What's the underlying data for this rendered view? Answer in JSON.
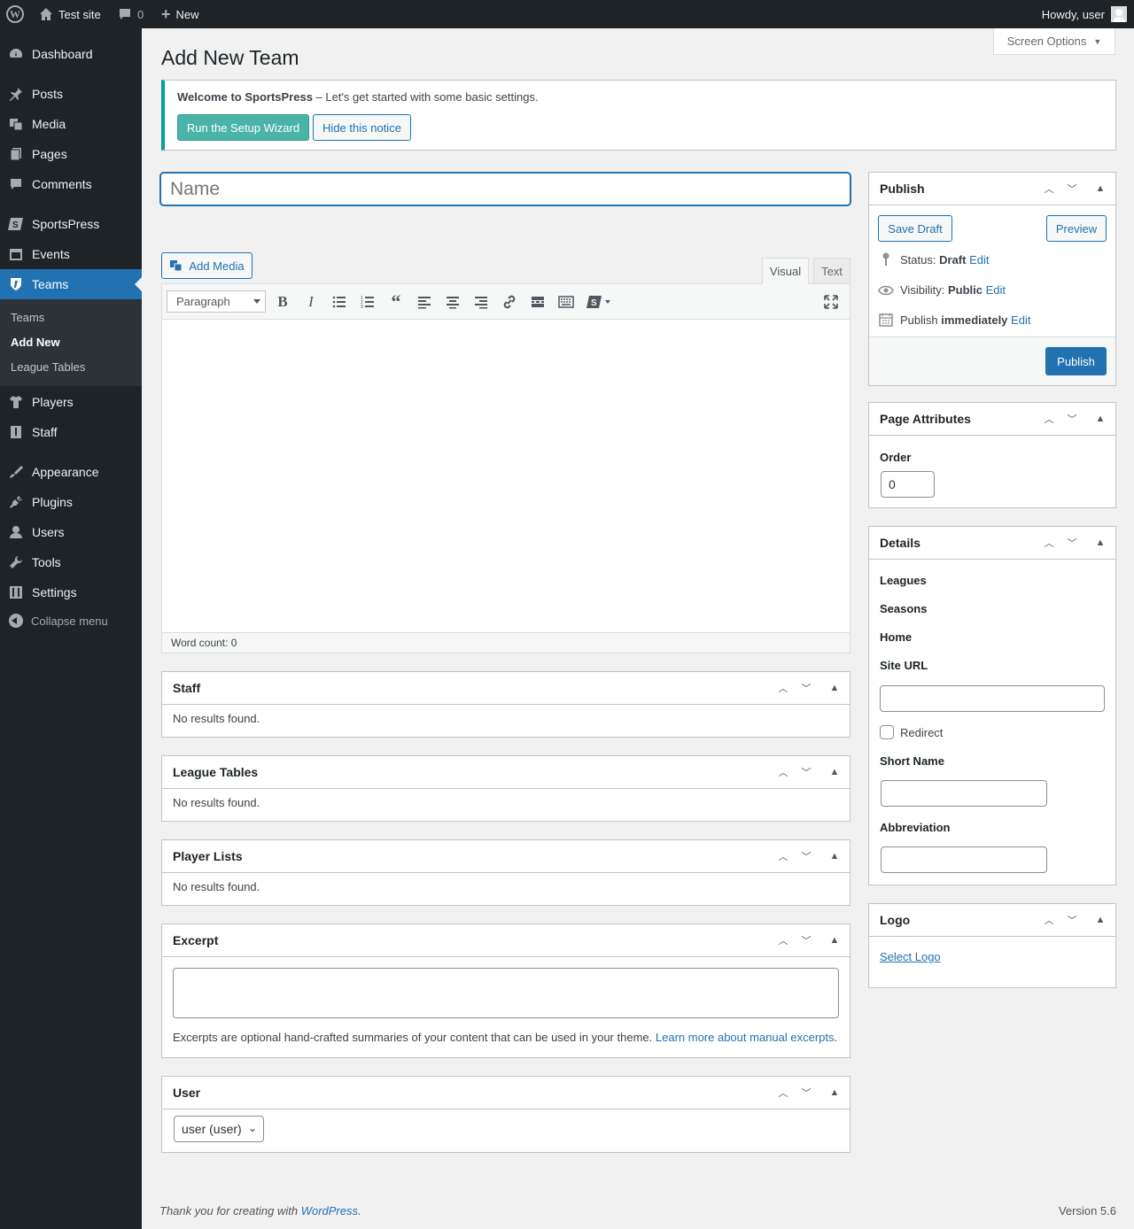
{
  "adminbar": {
    "site_name": "Test site",
    "comments_count": "0",
    "new_label": "New",
    "howdy": "Howdy, user"
  },
  "sidebar": {
    "items": [
      {
        "label": "Dashboard",
        "icon": "dashboard-icon"
      },
      {
        "label": "Posts",
        "icon": "pin-icon"
      },
      {
        "label": "Media",
        "icon": "media-icon"
      },
      {
        "label": "Pages",
        "icon": "page-icon"
      },
      {
        "label": "Comments",
        "icon": "comment-icon"
      },
      {
        "label": "SportsPress",
        "icon": "sportspress-icon"
      },
      {
        "label": "Events",
        "icon": "calendar-icon"
      },
      {
        "label": "Teams",
        "icon": "shield-icon"
      },
      {
        "label": "Players",
        "icon": "shirt-icon"
      },
      {
        "label": "Staff",
        "icon": "staff-icon"
      },
      {
        "label": "Appearance",
        "icon": "brush-icon"
      },
      {
        "label": "Plugins",
        "icon": "plug-icon"
      },
      {
        "label": "Users",
        "icon": "user-icon"
      },
      {
        "label": "Tools",
        "icon": "wrench-icon"
      },
      {
        "label": "Settings",
        "icon": "sliders-icon"
      }
    ],
    "submenu": [
      "Teams",
      "Add New",
      "League Tables"
    ],
    "collapse_label": "Collapse menu"
  },
  "screen_options": "Screen Options",
  "page_title": "Add New Team",
  "notice": {
    "strong": "Welcome to SportsPress",
    "text": " – Let's get started with some basic settings.",
    "primary_btn": "Run the Setup Wizard",
    "secondary_btn": "Hide this notice"
  },
  "title_placeholder": "Name",
  "editor": {
    "add_media": "Add Media",
    "tab_visual": "Visual",
    "tab_text": "Text",
    "format_select": "Paragraph",
    "word_count": "Word count: 0"
  },
  "boxes": {
    "staff": {
      "title": "Staff",
      "empty": "No results found."
    },
    "league_tables": {
      "title": "League Tables",
      "empty": "No results found."
    },
    "player_lists": {
      "title": "Player Lists",
      "empty": "No results found."
    },
    "excerpt": {
      "title": "Excerpt",
      "help": "Excerpts are optional hand-crafted summaries of your content that can be used in your theme.",
      "link": "Learn more about manual excerpts",
      "period": "."
    },
    "user": {
      "title": "User",
      "selected": "user (user)"
    }
  },
  "publish": {
    "title": "Publish",
    "save_draft": "Save Draft",
    "preview": "Preview",
    "status_label": "Status:",
    "status_value": "Draft",
    "visibility_label": "Visibility:",
    "visibility_value": "Public",
    "publish_label": "Publish",
    "publish_value": "immediately",
    "edit": "Edit",
    "publish_btn": "Publish"
  },
  "page_attributes": {
    "title": "Page Attributes",
    "order_label": "Order",
    "order_value": "0"
  },
  "details": {
    "title": "Details",
    "leagues": "Leagues",
    "seasons": "Seasons",
    "home": "Home",
    "site_url": "Site URL",
    "redirect": "Redirect",
    "short_name": "Short Name",
    "abbreviation": "Abbreviation"
  },
  "logo": {
    "title": "Logo",
    "select": "Select Logo"
  },
  "footer": {
    "thanks_prefix": "Thank you for creating with ",
    "wordpress": "WordPress",
    "suffix": ".",
    "version": "Version 5.6"
  }
}
